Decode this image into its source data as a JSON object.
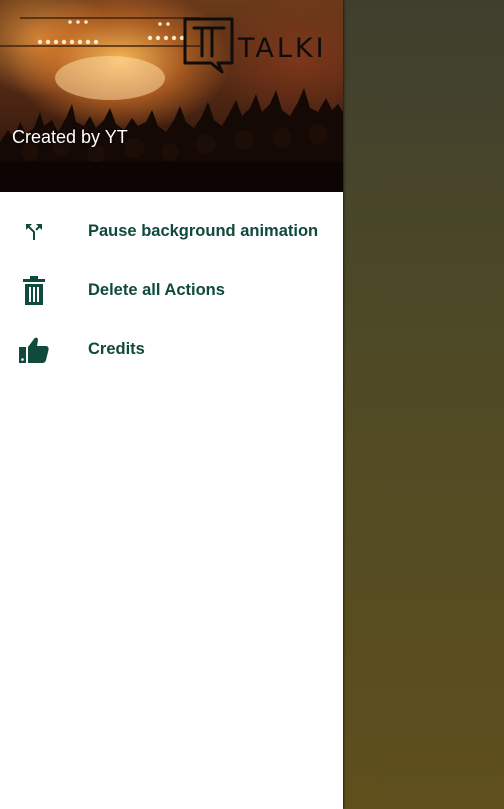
{
  "scrim_colors": {
    "top": "#3f3f2e",
    "bottom": "#5f4f1d"
  },
  "drawer": {
    "header": {
      "logo_text": "TALKI",
      "subtitle": "Created by YT"
    },
    "menu": [
      {
        "icon": "call-split-icon",
        "label": "Pause background animation"
      },
      {
        "icon": "trash-icon",
        "label": "Delete all Actions"
      },
      {
        "icon": "thumbs-up-icon",
        "label": "Credits"
      }
    ],
    "accent_color": "#0f4a3c"
  }
}
